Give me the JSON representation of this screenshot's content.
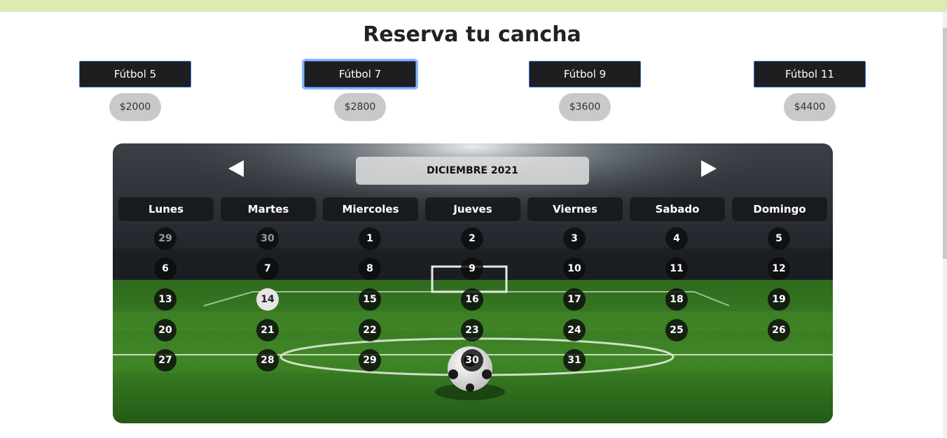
{
  "page": {
    "title": "Reserva tu cancha"
  },
  "plans": [
    {
      "label": "Fútbol 5",
      "price": "$2000"
    },
    {
      "label": "Fútbol 7",
      "price": "$2800"
    },
    {
      "label": "Fútbol 9",
      "price": "$3600"
    },
    {
      "label": "Fútbol 11",
      "price": "$4400"
    }
  ],
  "calendar": {
    "month": "DICIEMBRE 2021",
    "weekdays": [
      "Lunes",
      "Martes",
      "Miercoles",
      "Jueves",
      "Viernes",
      "Sabado",
      "Domingo"
    ],
    "weeks": [
      [
        "29",
        "30",
        "1",
        "2",
        "3",
        "4",
        "5"
      ],
      [
        "6",
        "7",
        "8",
        "9",
        "10",
        "11",
        "12"
      ],
      [
        "13",
        "14",
        "15",
        "16",
        "17",
        "18",
        "19"
      ],
      [
        "20",
        "21",
        "22",
        "23",
        "24",
        "25",
        "26"
      ],
      [
        "27",
        "28",
        "29",
        "30",
        "31"
      ]
    ],
    "selected_day": "14"
  },
  "icons": {
    "prev": "triangle-left-icon",
    "next": "triangle-right-icon",
    "background": "soccer-stadium-image"
  },
  "colors": {
    "accent": "#8ab4f8",
    "button_bg": "#1e1e20",
    "top_bar": "#dcebb0"
  }
}
